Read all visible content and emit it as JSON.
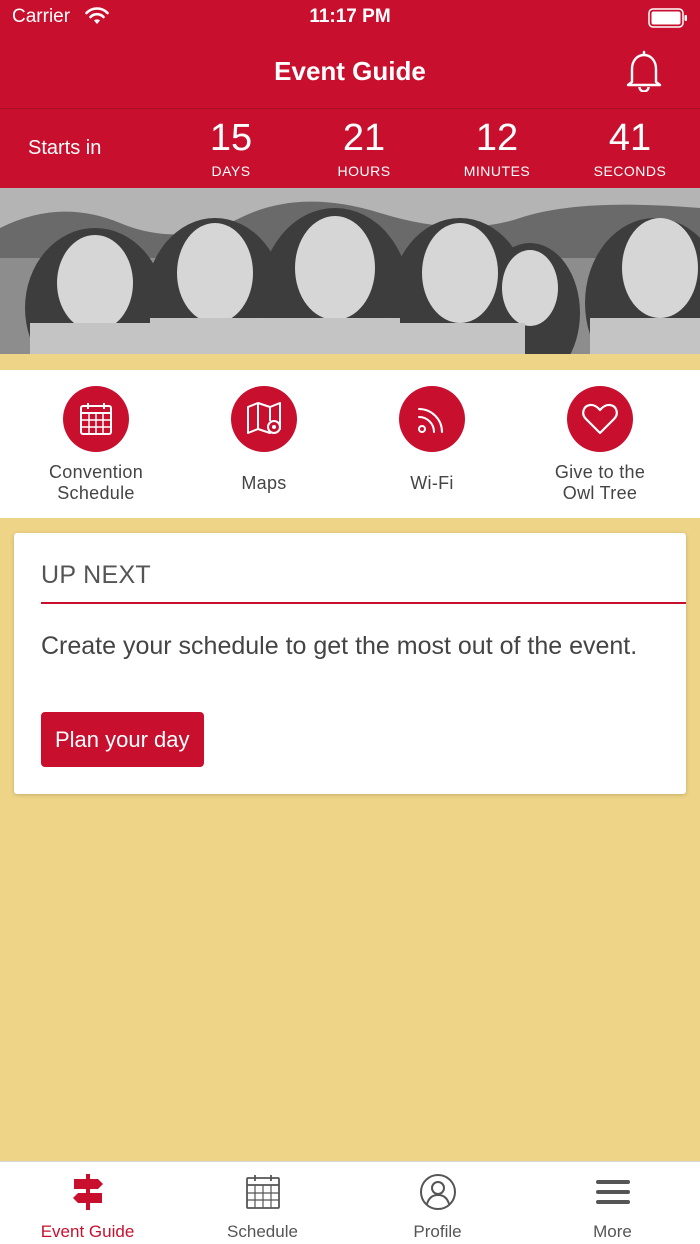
{
  "status_bar": {
    "carrier": "Carrier",
    "time": "11:17 PM"
  },
  "nav": {
    "title": "Event Guide"
  },
  "countdown": {
    "label": "Starts in",
    "units": [
      {
        "value": "15",
        "label": "DAYS"
      },
      {
        "value": "21",
        "label": "HOURS"
      },
      {
        "value": "12",
        "label": "MINUTES"
      },
      {
        "value": "41",
        "label": "SECONDS"
      }
    ]
  },
  "quick_links": [
    {
      "label": "Convention\nSchedule",
      "icon": "calendar-icon"
    },
    {
      "label": "Maps",
      "icon": "map-icon"
    },
    {
      "label": "Wi-Fi",
      "icon": "wifi-icon"
    },
    {
      "label": "Give to the\nOwl Tree",
      "icon": "heart-icon"
    }
  ],
  "up_next": {
    "heading": "UP NEXT",
    "message": "Create your schedule to get the most out of the event.",
    "button_label": "Plan your day"
  },
  "tabs": [
    {
      "label": "Event Guide",
      "icon": "signpost-icon",
      "active": true
    },
    {
      "label": "Schedule",
      "icon": "calendar-icon",
      "active": false
    },
    {
      "label": "Profile",
      "icon": "user-icon",
      "active": false
    },
    {
      "label": "More",
      "icon": "menu-icon",
      "active": false
    }
  ],
  "colors": {
    "primary": "#C8102E",
    "background": "#EED486",
    "surface": "#FFFFFF"
  }
}
